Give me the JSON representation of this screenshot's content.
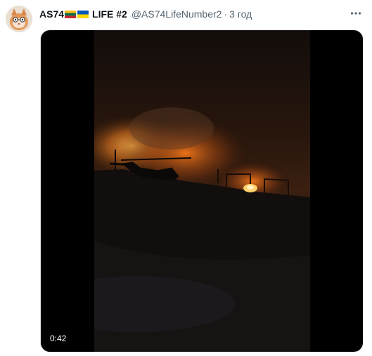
{
  "tweet": {
    "display_name": "AS74",
    "display_name_suffix": "LIFE #2",
    "handle": "@AS74LifeNumber2",
    "separator": "·",
    "time": "3 год",
    "flags": [
      "lithuania-flag",
      "ukraine-flag"
    ],
    "more_icon": "more-dots-icon"
  },
  "media": {
    "type": "video",
    "duration": "0:42",
    "scene": "night fire with helicopter silhouette"
  },
  "colors": {
    "name": "#0f1419",
    "secondary": "#536471",
    "media_background": "#000000",
    "fire_orange": "#ff8c1a"
  }
}
